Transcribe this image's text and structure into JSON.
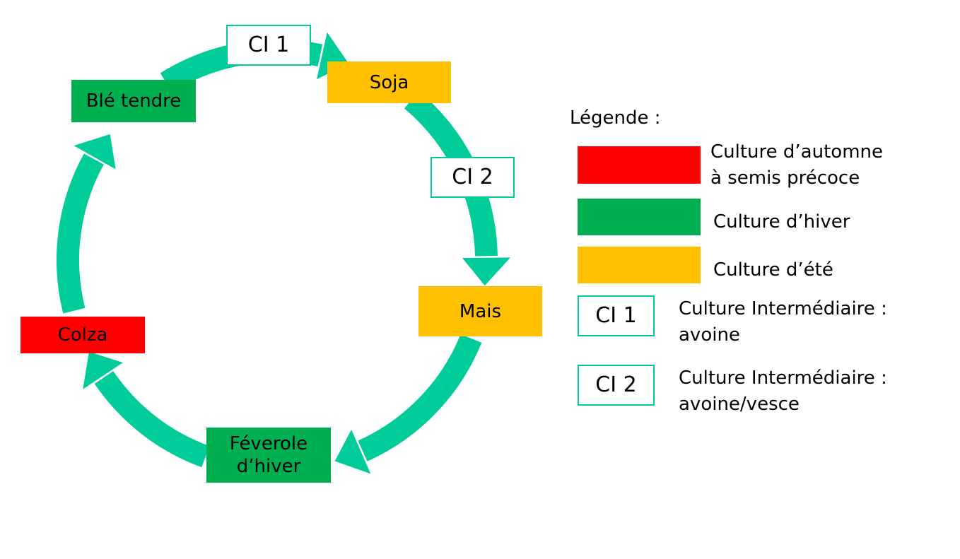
{
  "colors": {
    "arrow": "#00CC99",
    "autumn_early": "#FF0000",
    "winter": "#00B050",
    "summer": "#FFC000",
    "intermediate_border": "#00CC99"
  },
  "rotation": {
    "ci1": "CI 1",
    "soja": "Soja",
    "ci2": "CI 2",
    "mais": "Mais",
    "feverole": "Féverole d’hiver",
    "colza": "Colza",
    "ble": "Blé tendre"
  },
  "legend": {
    "title": "Légende :",
    "items": [
      {
        "label": "Culture d’automne à semis précoce",
        "line1": "Culture d’automne",
        "line2": "à semis précoce"
      },
      {
        "label": "Culture d’hiver"
      },
      {
        "label": "Culture d’été"
      },
      {
        "code": "CI 1",
        "line1": "Culture Intermédiaire :",
        "line2": "avoine"
      },
      {
        "code": "CI 2",
        "line1": "Culture Intermédiaire :",
        "line2": "avoine/vesce"
      }
    ]
  }
}
